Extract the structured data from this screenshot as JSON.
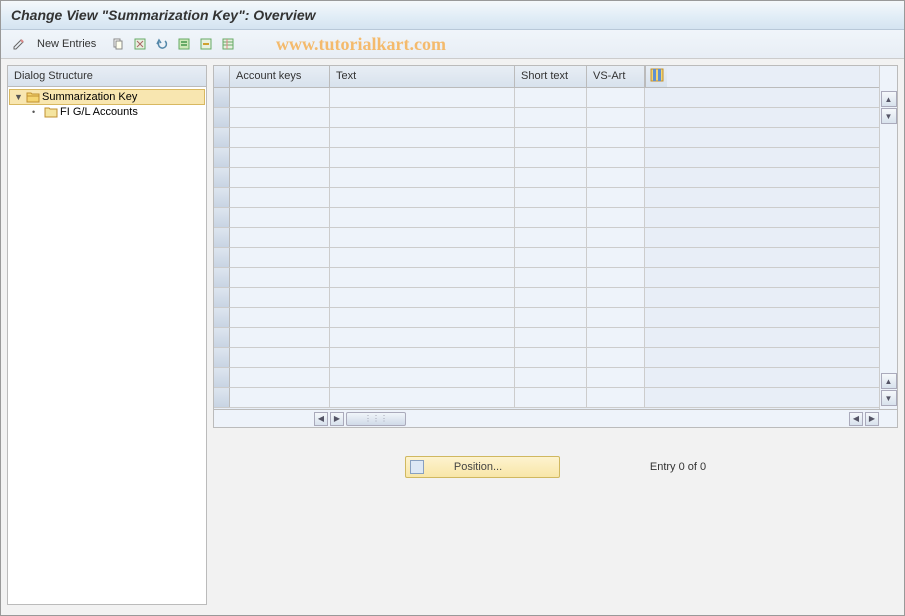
{
  "title": "Change View \"Summarization Key\": Overview",
  "toolbar": {
    "new_entries_label": "New Entries"
  },
  "watermark": "www.tutorialkart.com",
  "dialog_structure": {
    "header": "Dialog Structure",
    "items": [
      {
        "label": "Summarization Key",
        "selected": true,
        "open": true,
        "level": 0
      },
      {
        "label": "FI G/L Accounts",
        "selected": false,
        "open": false,
        "level": 1
      }
    ]
  },
  "table": {
    "columns": [
      {
        "label": "Account keys"
      },
      {
        "label": "Text"
      },
      {
        "label": "Short text"
      },
      {
        "label": "VS-Art"
      }
    ],
    "rows": []
  },
  "footer": {
    "position_label": "Position...",
    "entry_text": "Entry 0 of 0"
  }
}
